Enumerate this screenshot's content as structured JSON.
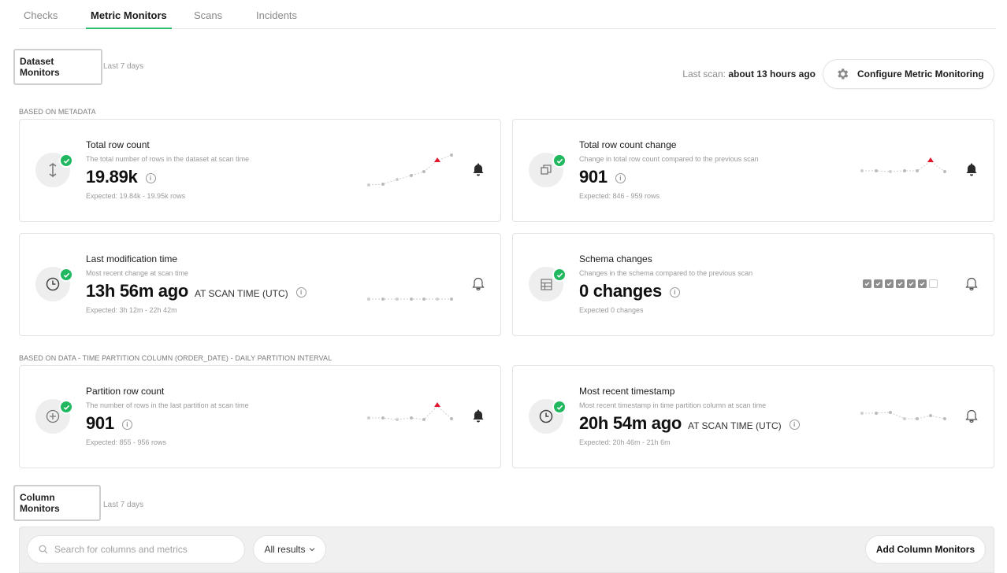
{
  "tabs": [
    {
      "label": "Checks",
      "active": false
    },
    {
      "label": "Metric Monitors",
      "active": true
    },
    {
      "label": "Scans",
      "active": false
    },
    {
      "label": "Incidents",
      "active": false
    }
  ],
  "dataset_section": {
    "title": "Dataset Monitors",
    "period": "Last 7 days"
  },
  "last_scan": {
    "label": "Last scan:",
    "value": "about 13 hours ago"
  },
  "configure_button": {
    "label": "Configure Metric Monitoring",
    "icon": "gear-icon"
  },
  "groups": {
    "metadata": "BASED ON METADATA",
    "data": "BASED ON DATA - TIME PARTITION COLUMN (ORDER_DATE) - DAILY PARTITION INTERVAL"
  },
  "cards": {
    "total_row_count": {
      "title": "Total row count",
      "description": "The total number of rows in the dataset at scan time",
      "value": "19.89k",
      "unit": "",
      "expected": "Expected: 19.84k - 19.95k rows",
      "icon": "vertical-arrows-icon",
      "status": "passing",
      "alerting": true
    },
    "total_row_count_change": {
      "title": "Total row count change",
      "description": "Change in total row count compared to the previous scan",
      "value": "901",
      "unit": "",
      "expected": "Expected: 846 - 959 rows",
      "icon": "copy-icon",
      "status": "passing",
      "alerting": true
    },
    "last_modification_time": {
      "title": "Last modification time",
      "description": "Most recent change at scan time",
      "value": "13h 56m ago",
      "unit": "AT SCAN TIME (UTC)",
      "expected": "Expected: 3h 12m - 22h 42m",
      "icon": "clock-icon",
      "status": "passing",
      "alerting": false
    },
    "schema_changes": {
      "title": "Schema changes",
      "description": "Changes in the schema compared to the previous scan",
      "value": "0 changes",
      "unit": "",
      "expected": "Expected 0 changes",
      "icon": "table-icon",
      "status": "passing",
      "alerting": false,
      "history": [
        true,
        true,
        true,
        true,
        true,
        true,
        false
      ]
    },
    "partition_row_count": {
      "title": "Partition row count",
      "description": "The number of rows in the last partition at scan time",
      "value": "901",
      "unit": "",
      "expected": "Expected: 855 - 956 rows",
      "icon": "plus-circle-icon",
      "status": "passing",
      "alerting": true
    },
    "most_recent_timestamp": {
      "title": "Most recent timestamp",
      "description": "Most recent timestamp in time partition column at scan time",
      "value": "20h 54m ago",
      "unit": "AT SCAN TIME (UTC)",
      "expected": "Expected: 20h 46m - 21h 6m",
      "icon": "clock-icon",
      "status": "passing",
      "alerting": false
    }
  },
  "column_section": {
    "title": "Column Monitors",
    "period": "Last 7 days"
  },
  "column_toolbar": {
    "search_placeholder": "Search for columns and metrics",
    "filter_label": "All results",
    "add_button": "Add Column Monitors"
  },
  "colors": {
    "accent": "#2bbf6d",
    "pass": "#21b75f",
    "anomaly": "#e0182d"
  }
}
